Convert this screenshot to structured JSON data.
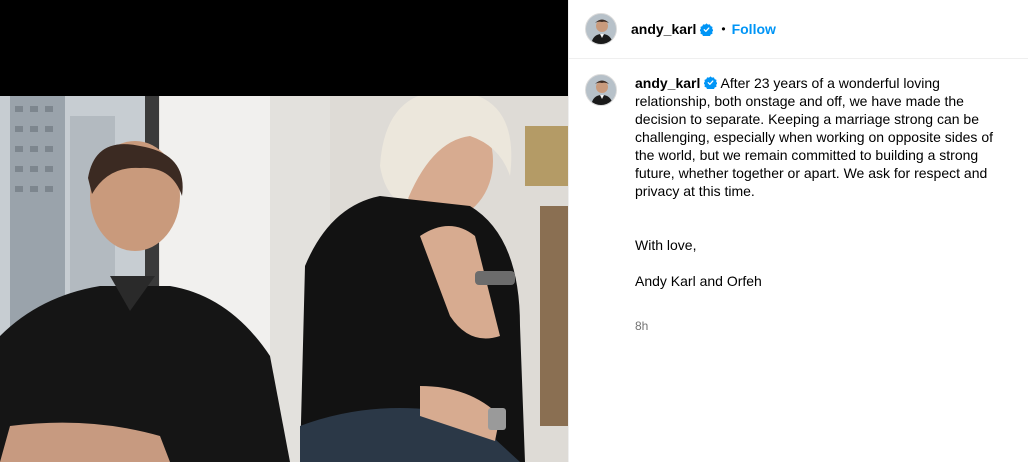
{
  "post": {
    "username": "andy_karl",
    "verified": true,
    "follow_label": "Follow",
    "separator": "•",
    "caption_text": "After 23 years of a wonderful loving relationship, both onstage and off, we have made the decision to separate. Keeping a marriage strong can be challenging, especially when working on opposite sides of the world, but we remain committed to building a strong future, whether together or apart. We ask for respect and privacy at this time.",
    "signoff_line1": "With love,",
    "signoff_line2": "Andy Karl and Orfeh",
    "time_ago": "8h"
  },
  "colors": {
    "accent": "#0095f6",
    "verified_badge": "#0095f6",
    "muted_text": "#737373",
    "media_background": "#000000"
  }
}
